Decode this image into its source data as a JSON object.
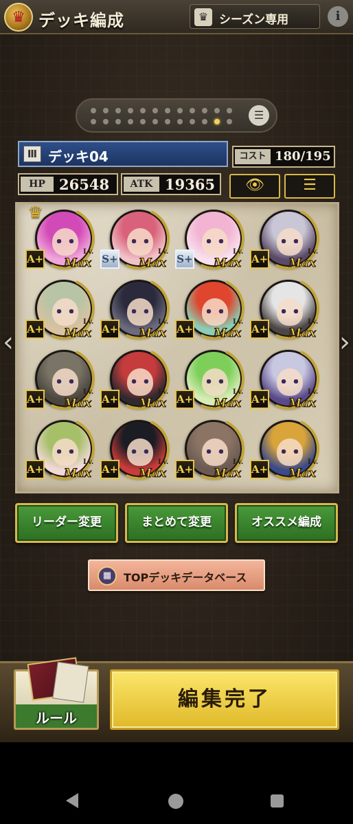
{
  "header": {
    "title": "デッキ編成",
    "season_label": "シーズン専用",
    "info_glyph": "i"
  },
  "pager": {
    "page_count": 24,
    "active_index": 22
  },
  "deck": {
    "name": "デッキ04",
    "cost_label": "コスト",
    "cost_value": "180/195",
    "hp_label": "HP",
    "hp_value": "26548",
    "atk_label": "ATK",
    "atk_value": "19365"
  },
  "cards": [
    {
      "rarity": "A+",
      "lv": "Lv.",
      "max": "Max",
      "hair": "#d24ab8",
      "bg": "#f0a6d8",
      "leader": true
    },
    {
      "rarity": "S+",
      "lv": "Lv.",
      "max": "Max",
      "hair": "#d9627a",
      "bg": "#f1c2c8",
      "leader": false
    },
    {
      "rarity": "S+",
      "lv": "Lv.",
      "max": "Max",
      "hair": "#f2b4d2",
      "bg": "#f8e1ec",
      "leader": false
    },
    {
      "rarity": "A+",
      "lv": "Lv.",
      "max": "Max",
      "hair": "#c9c6d6",
      "bg": "#5a4a66",
      "leader": false
    },
    {
      "rarity": "A+",
      "lv": "Lv.",
      "max": "Max",
      "hair": "#b7c4a6",
      "bg": "#d9c2a0",
      "leader": false
    },
    {
      "rarity": "A+",
      "lv": "Lv.",
      "max": "Max",
      "hair": "#2a2a3c",
      "bg": "#6c6a7e",
      "leader": false
    },
    {
      "rarity": "A+",
      "lv": "Lv.",
      "max": "Max",
      "hair": "#e0452e",
      "bg": "#8acfb5",
      "leader": false
    },
    {
      "rarity": "A+",
      "lv": "Lv.",
      "max": "Max",
      "hair": "#e5e5e5",
      "bg": "#4c4646",
      "leader": false
    },
    {
      "rarity": "A+",
      "lv": "Lv.",
      "max": "Max",
      "hair": "#7a7466",
      "bg": "#4a463e",
      "leader": false
    },
    {
      "rarity": "A+",
      "lv": "Lv.",
      "max": "Max",
      "hair": "#c63c3c",
      "bg": "#2e2a30",
      "leader": false
    },
    {
      "rarity": "A+",
      "lv": "Lv.",
      "max": "Max",
      "hair": "#7dcf5a",
      "bg": "#d8ecb8",
      "leader": false
    },
    {
      "rarity": "A+",
      "lv": "Lv.",
      "max": "Max",
      "hair": "#c8c8e0",
      "bg": "#5a4a8a",
      "leader": false
    },
    {
      "rarity": "A+",
      "lv": "Lv.",
      "max": "Max",
      "hair": "#a6c06a",
      "bg": "#f2d8d8",
      "leader": false
    },
    {
      "rarity": "A+",
      "lv": "Lv.",
      "max": "Max",
      "hair": "#1c1c24",
      "bg": "#c93c3a",
      "leader": false
    },
    {
      "rarity": "A+",
      "lv": "Lv.",
      "max": "Max",
      "hair": "#8c7464",
      "bg": "#6a5a52",
      "leader": false
    },
    {
      "rarity": "A+",
      "lv": "Lv.",
      "max": "Max",
      "hair": "#d9a43a",
      "bg": "#3a4a8a",
      "leader": false
    }
  ],
  "buttons": {
    "leader_change": "リーダー変更",
    "bulk_change": "まとめて変更",
    "recommended": "オススメ編成",
    "top_deck_db": "TOPデッキデータベース",
    "rules": "ルール",
    "done": "編集完了"
  },
  "icons": {
    "crown": "crown-icon",
    "season": "season-crown-icon",
    "info": "info-icon",
    "list": "list-icon",
    "deck_number": "deck-number-icon",
    "eye": "eye-icon",
    "menu": "menu-icon"
  },
  "colors": {
    "accent_gold": "#d9b84a",
    "button_green": "#3c8a30",
    "done_yellow": "#f3d44a",
    "deck_bar_blue": "#2e4f8a"
  }
}
